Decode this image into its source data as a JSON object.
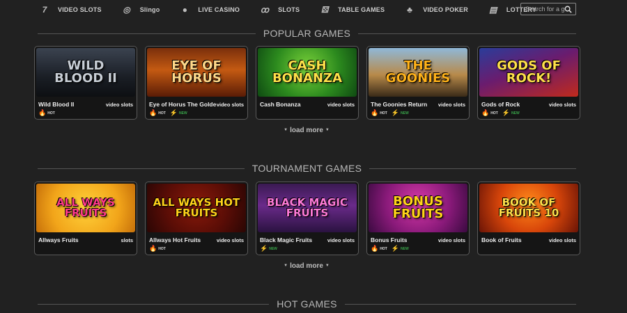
{
  "nav": {
    "items": [
      {
        "label": "VIDEO SLOTS",
        "icon": "777-icon",
        "glyph": "7"
      },
      {
        "label": "Slingo",
        "icon": "slingo-ball-icon",
        "glyph": "◎"
      },
      {
        "label": "LIVE CASINO",
        "icon": "live-casino-icon",
        "glyph": "●"
      },
      {
        "label": "SLOTS",
        "icon": "cherries-icon",
        "glyph": "ꝏ"
      },
      {
        "label": "TABLE GAMES",
        "icon": "dice-icon",
        "glyph": "⚄"
      },
      {
        "label": "VIDEO POKER",
        "icon": "club-icon",
        "glyph": "♣"
      },
      {
        "label": "LOTTERY",
        "icon": "lottery-icon",
        "glyph": "▤"
      }
    ],
    "search_placeholder": "Search for a game"
  },
  "sections": [
    {
      "title": "POPULAR GAMES",
      "load_more": "load more",
      "games": [
        {
          "name": "Wild Blood II",
          "type": "video slots",
          "thumb": "WILD BLOOD II",
          "theme": "t-wild",
          "color": "#c8ced6",
          "hot": true,
          "new": false
        },
        {
          "name": "Eye of Horus The Golden Tablet",
          "type": "video slots",
          "thumb": "EYE OF HORUS",
          "theme": "t-horus",
          "color": "#ffd98a",
          "hot": true,
          "new": true
        },
        {
          "name": "Cash Bonanza",
          "type": "video slots",
          "thumb": "CASH BONANZA",
          "theme": "t-cash",
          "color": "#ffe14a",
          "hot": false,
          "new": false
        },
        {
          "name": "The Goonies Return",
          "type": "video slots",
          "thumb": "THE GOONIES",
          "theme": "t-goon",
          "color": "#ffb21a",
          "hot": true,
          "new": true
        },
        {
          "name": "Gods of Rock",
          "type": "video slots",
          "thumb": "GODS OF ROCK!",
          "theme": "t-gods",
          "color": "#ffe04a",
          "hot": true,
          "new": true
        }
      ]
    },
    {
      "title": "TOURNAMENT GAMES",
      "load_more": "load more",
      "games": [
        {
          "name": "Allways Fruits",
          "type": "slots",
          "thumb": "ALL WAYS FRUITS",
          "theme": "t-allw",
          "color": "#ff3a8a",
          "hot": false,
          "new": false
        },
        {
          "name": "Allways Hot Fruits",
          "type": "video slots",
          "thumb": "ALL WAYS HOT FRUITS",
          "theme": "t-hotf",
          "color": "#ffd21a",
          "hot": true,
          "new": false
        },
        {
          "name": "Black Magic Fruits",
          "type": "video slots",
          "thumb": "BLACK MAGIC FRUITS",
          "theme": "t-black",
          "color": "#ff7ad8",
          "hot": false,
          "new": true
        },
        {
          "name": "Bonus Fruits",
          "type": "video slots",
          "thumb": "BONUS FRUITS",
          "theme": "t-bonus",
          "color": "#ffd21a",
          "hot": true,
          "new": true
        },
        {
          "name": "Book of Fruits",
          "type": "video slots",
          "thumb": "BOOK OF FRUITS 10",
          "theme": "t-book",
          "color": "#ffe04a",
          "hot": false,
          "new": false
        }
      ]
    },
    {
      "title": "HOT GAMES"
    }
  ],
  "badges": {
    "hot": "HOT",
    "new": "NEW"
  }
}
